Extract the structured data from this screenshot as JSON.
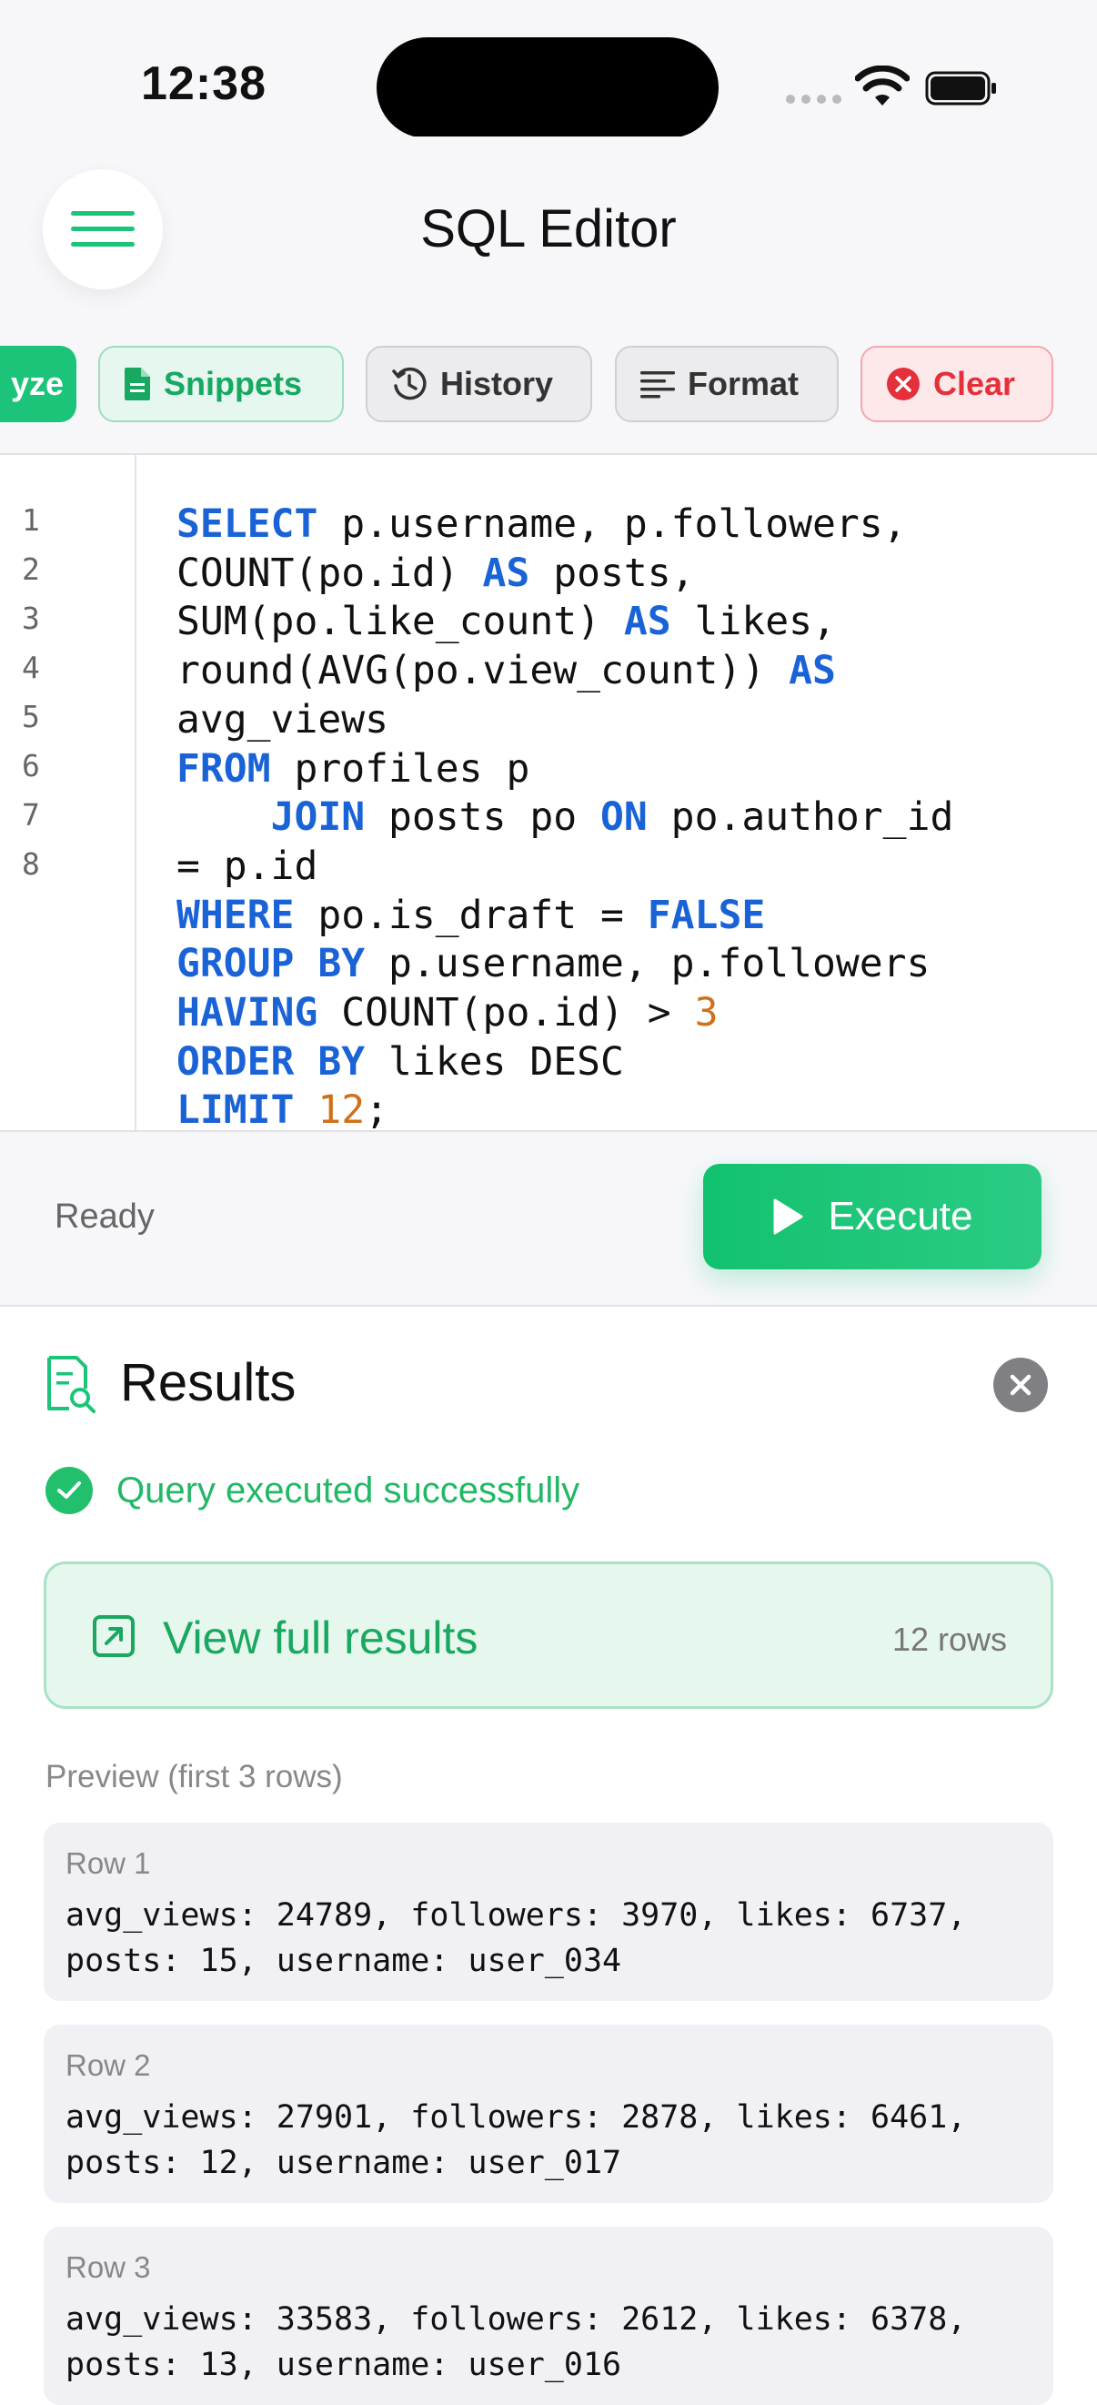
{
  "status_bar": {
    "time": "12:38"
  },
  "header": {
    "title": "SQL Editor"
  },
  "toolbar": {
    "analyze_label": "yze",
    "snippets_label": "Snippets",
    "history_label": "History",
    "format_label": "Format",
    "clear_label": "Clear"
  },
  "editor": {
    "line_numbers": [
      "1",
      "2",
      "3",
      "4",
      "5",
      "6",
      "7",
      "8"
    ]
  },
  "exec": {
    "status": "Ready",
    "execute_label": "Execute"
  },
  "results": {
    "title": "Results",
    "status_message": "Query executed successfully",
    "view_full_label": "View full results",
    "row_count": "12 rows",
    "preview_label": "Preview (first 3 rows)",
    "rows": [
      {
        "title": "Row 1",
        "line1": "avg_views: 24789, followers: 3970, likes: 6737,",
        "line2": "posts: 15, username: user_034"
      },
      {
        "title": "Row 2",
        "line1": "avg_views: 27901, followers: 2878, likes: 6461,",
        "line2": "posts: 12, username: user_017"
      },
      {
        "title": "Row 3",
        "line1": "avg_views: 33583, followers: 2612, likes: 6378,",
        "line2": "posts: 13, username: user_016"
      }
    ]
  },
  "colors": {
    "accent": "#1cc47a",
    "keyword": "#1a63d6",
    "number": "#d0701a",
    "danger": "#e5303b"
  }
}
